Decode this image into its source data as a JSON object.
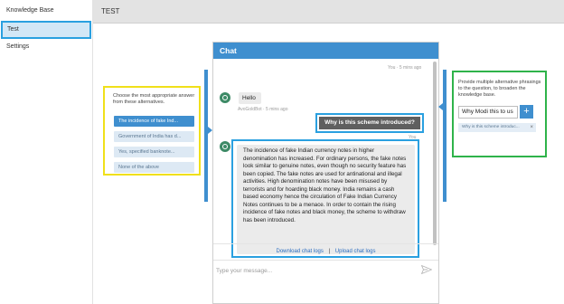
{
  "sidebar": {
    "items": [
      {
        "label": "Knowledge Base"
      },
      {
        "label": "Test"
      },
      {
        "label": "Settings"
      }
    ]
  },
  "header": {
    "title": "TEST"
  },
  "alternatives": {
    "caption": "Choose the most appropriate answer from these alternatives.",
    "options": [
      {
        "label": "The incidence of fake Ind..."
      },
      {
        "label": "Government of India has d..."
      },
      {
        "label": "Yes, specified banknote..."
      },
      {
        "label": "None of the above"
      }
    ]
  },
  "chat": {
    "title": "Chat",
    "top_timestamp": "You · 5 mins ago",
    "hello_text": "Hello",
    "hello_timestamp": "AvoGoldBot · 5 mins ago",
    "user_message": "Why is this scheme introduced?",
    "user_timestamp": "You",
    "bot_answer": "The incidence of fake Indian currency notes in higher denomination has increased. For ordinary persons, the fake notes look similar to genuine notes, even though no security feature has been copied. The fake notes are used for antinational and illegal activities. High denomination notes have been misused by terrorists and for hoarding black money. India remains a cash based economy hence the circulation of Fake Indian Currency Notes continues to be a menace. In order to contain the rising incidence of fake notes and black money, the scheme to withdraw has been introduced.",
    "download_link": "Download chat logs",
    "upload_link": "Upload chat logs",
    "link_separator": "|",
    "input_placeholder": "Type your message..."
  },
  "rephrase": {
    "caption": "Provide multiple alternative phrasings to the question, to broaden the knowledge base.",
    "input_value": "Why Modi this to us",
    "add_label": "+",
    "chip_label": "Why is this scheme introduc...",
    "chip_close": "×"
  },
  "colors": {
    "accent": "#3f8fcf",
    "highlight_blue": "#2aa0e0",
    "highlight_yellow": "#f0e01a",
    "highlight_green": "#2fb34a",
    "bot_avatar": "#3d8a66"
  }
}
